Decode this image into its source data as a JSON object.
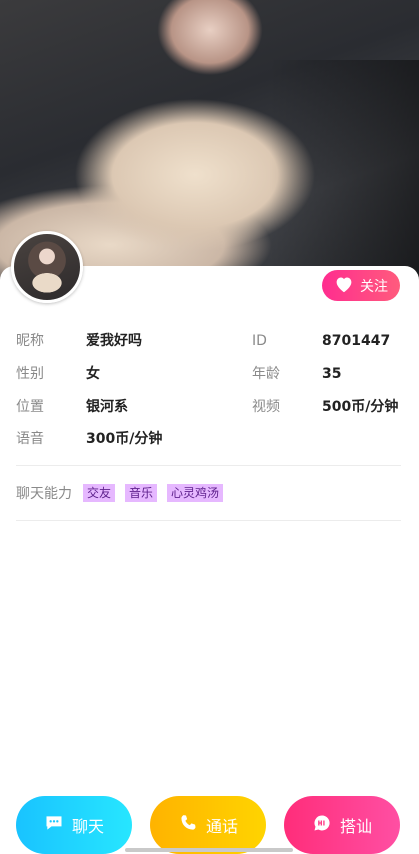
{
  "profile": {
    "follow_label": "关注",
    "fields": [
      {
        "label": "昵称",
        "value": "爱我好吗"
      },
      {
        "label": "ID",
        "value": "8701447"
      },
      {
        "label": "性别",
        "value": "女"
      },
      {
        "label": "年龄",
        "value": "35"
      },
      {
        "label": "位置",
        "value": "银河系"
      },
      {
        "label": "视频",
        "value": "500币/分钟"
      },
      {
        "label": "语音",
        "value": "300币/分钟"
      }
    ],
    "skills_label": "聊天能力",
    "skills": [
      "交友",
      "音乐",
      "心灵鸡汤"
    ]
  },
  "actions": {
    "chat_label": "聊天",
    "call_label": "通话",
    "hi_label": "搭讪"
  },
  "colors": {
    "follow": "#ff2d8f",
    "chat": "#19c3ff",
    "call": "#ffb300",
    "hi": "#ff2d7a",
    "tag_bg": "#e6b8ff"
  },
  "icons": {
    "follow": "heart-icon",
    "chat": "chat-bubble-icon",
    "call": "phone-icon",
    "hi": "hi-bubble-icon"
  }
}
